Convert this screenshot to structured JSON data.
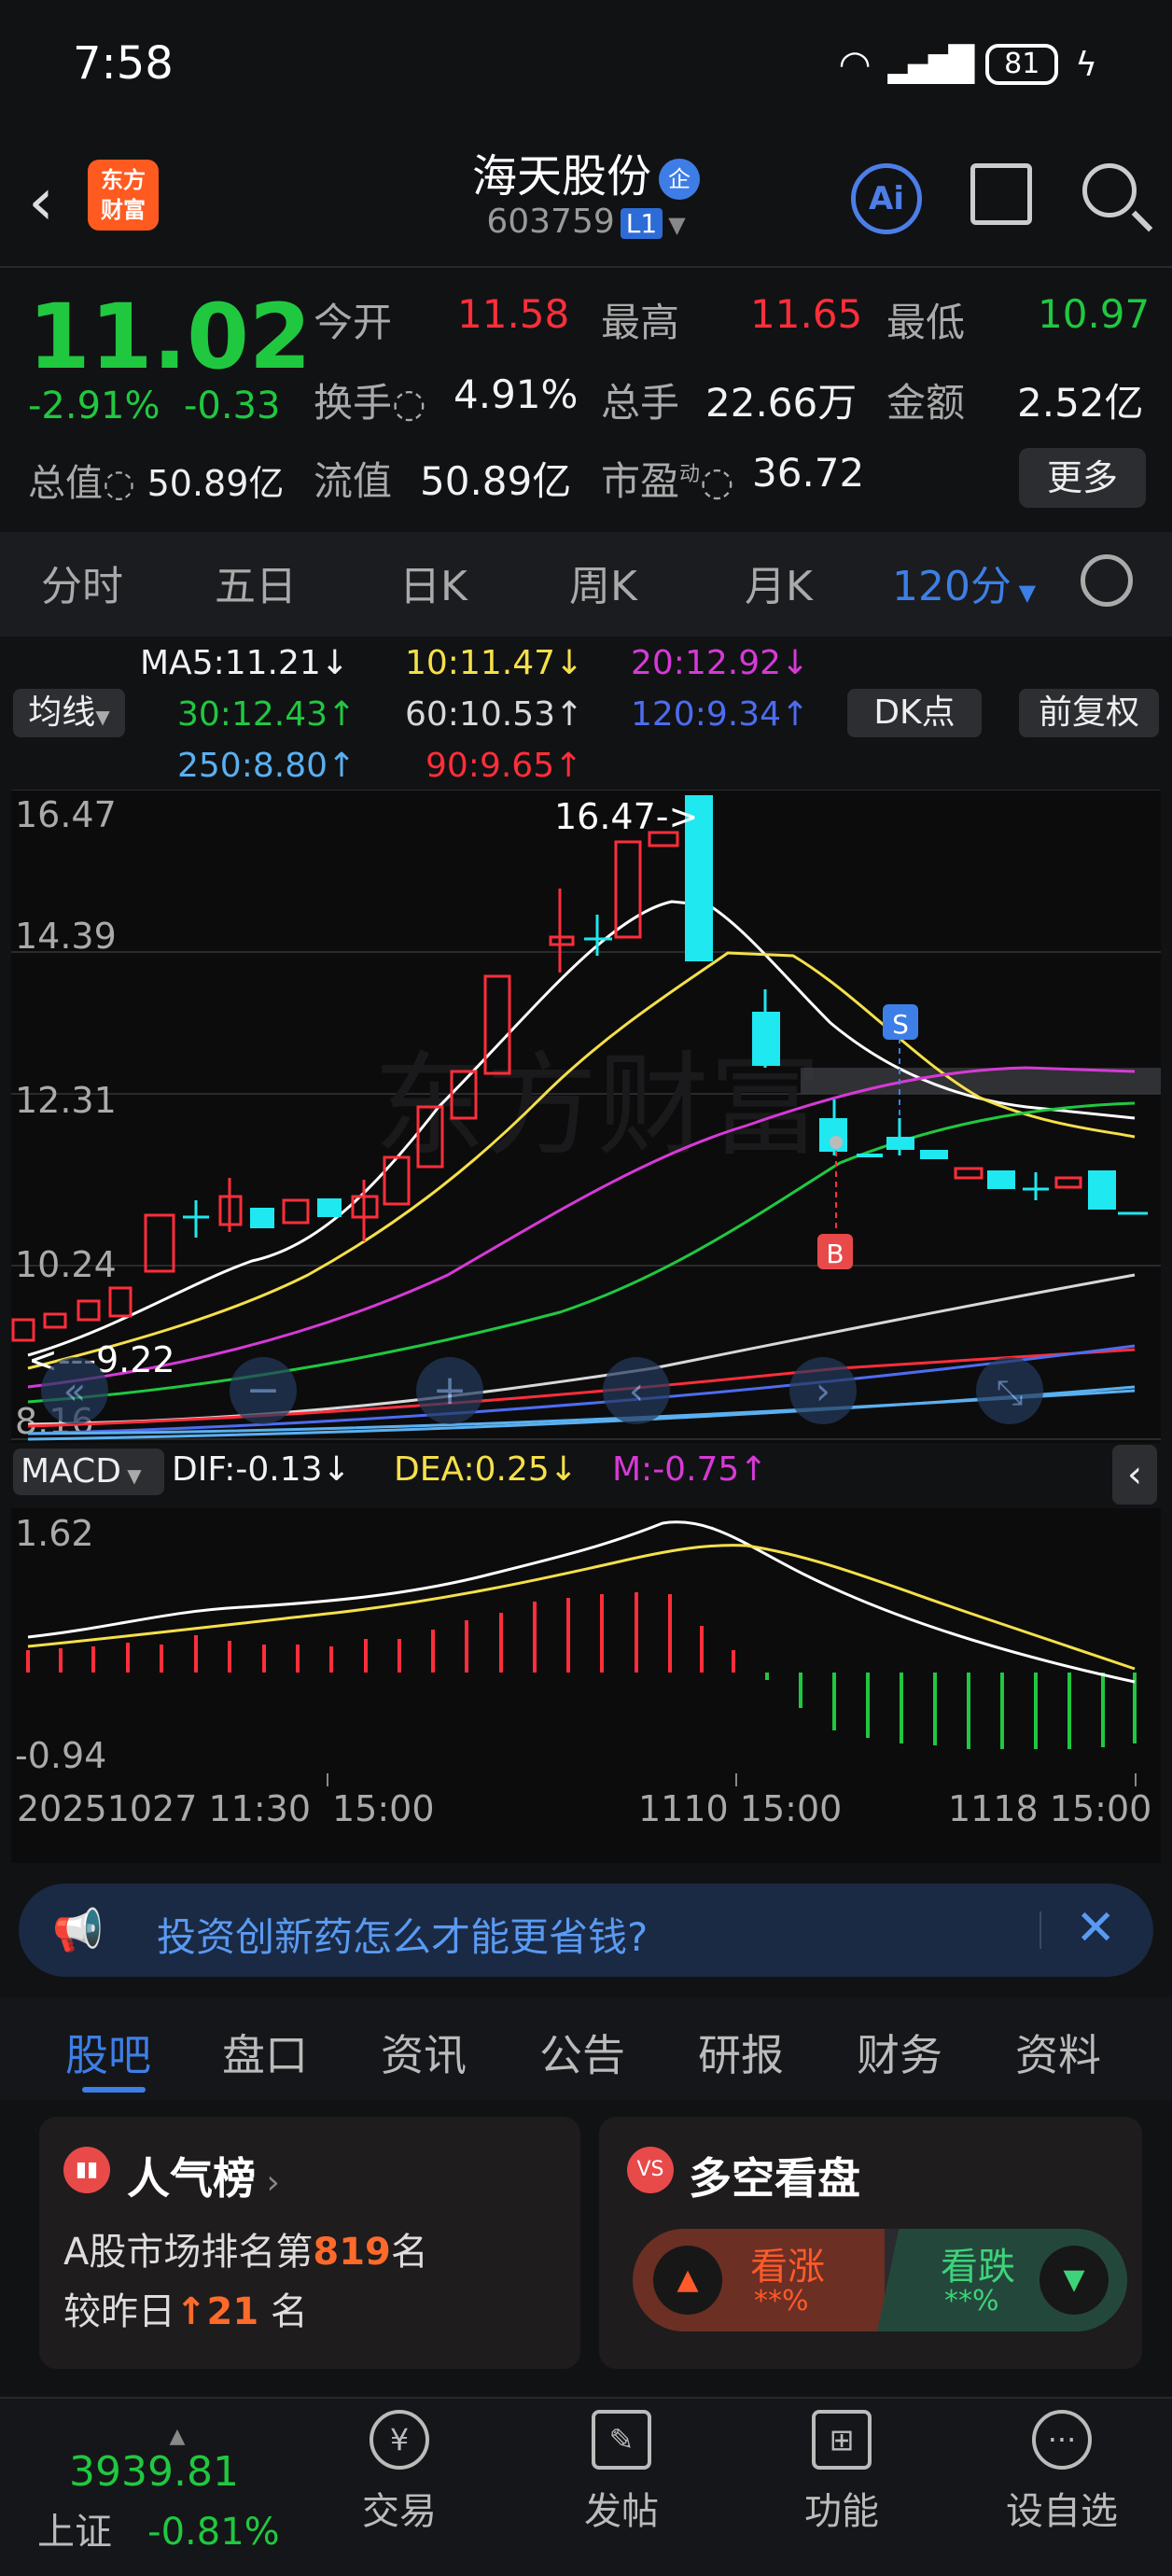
{
  "status": {
    "time": "7:58",
    "battery": "81"
  },
  "header": {
    "title": "海天股份",
    "badge": "企",
    "code": "603759",
    "level": "L1",
    "logo_text": "东方财富"
  },
  "quote": {
    "price": "11.02",
    "change_pct": "-2.91%",
    "change": "-0.33",
    "total_value_label": "总值",
    "total_value": "50.89亿",
    "fields": [
      {
        "label": "今开",
        "value": "11.58",
        "color": "red"
      },
      {
        "label": "最高",
        "value": "11.65",
        "color": "red"
      },
      {
        "label": "最低",
        "value": "10.97",
        "color": "green"
      },
      {
        "label": "换手",
        "value": "4.91%",
        "color": "white"
      },
      {
        "label": "总手",
        "value": "22.66万",
        "color": "white"
      },
      {
        "label": "金额",
        "value": "2.52亿",
        "color": "white"
      },
      {
        "label": "流值",
        "value": "50.89亿",
        "color": "white"
      },
      {
        "label": "市盈",
        "sup": "动",
        "value": "36.72",
        "color": "white"
      }
    ],
    "more_label": "更多"
  },
  "periods": [
    "分时",
    "五日",
    "日K",
    "周K",
    "月K",
    "120分"
  ],
  "ma_legend": {
    "selector": "均线",
    "items": [
      {
        "text": "MA5:11.21↓",
        "color": "#f2f2f2"
      },
      {
        "text": "10:11.47↓",
        "color": "#f5e04a"
      },
      {
        "text": "20:12.92↓",
        "color": "#d63ad6"
      },
      {
        "text": "30:12.43↑",
        "color": "#20c840"
      },
      {
        "text": "60:10.53↑",
        "color": "#d8d8d8"
      },
      {
        "text": "120:9.34↑",
        "color": "#4d6cf0"
      },
      {
        "text": "250:8.80↑",
        "color": "#5ab0f0"
      },
      {
        "text": "90:9.65↑",
        "color": "#ff2e3a"
      }
    ],
    "dk_label": "DK点",
    "adjust_label": "前复权"
  },
  "kchart": {
    "y_labels": [
      "16.47",
      "14.39",
      "12.31",
      "10.24",
      "8.16"
    ],
    "high_note": "16.47->",
    "low_note": "<---9.22",
    "markers": [
      "S",
      "B"
    ],
    "watermark": "东方财富"
  },
  "macd": {
    "selector": "MACD",
    "dif": "DIF:-0.13↓",
    "dea": "DEA:0.25↓",
    "m": "M:-0.75↑",
    "y_top": "1.62",
    "y_bottom": "-0.94"
  },
  "time_axis": [
    "20251027 11:30",
    "15:00",
    "1110 15:00",
    "1118 15:00"
  ],
  "banner": {
    "text": "投资创新药怎么才能更省钱?"
  },
  "content_tabs": [
    "股吧",
    "盘口",
    "资讯",
    "公告",
    "研报",
    "财务",
    "资料"
  ],
  "popularity": {
    "title": "人气榜",
    "rank_prefix": "A股市场排名第",
    "rank": "819",
    "rank_suffix": "名",
    "change_prefix": "较昨日",
    "change": "21",
    "change_suffix": "名"
  },
  "sentiment": {
    "title": "多空看盘",
    "up_label": "看涨",
    "up_pct": "**%",
    "down_label": "看跌",
    "down_pct": "**%"
  },
  "bottom_nav": {
    "index_value": "3939.81",
    "index_name": "上证",
    "index_change": "-0.81%",
    "items": [
      "交易",
      "发帖",
      "功能",
      "设自选"
    ]
  },
  "colors": {
    "up": "#ff2e3a",
    "down": "#20c840",
    "accent": "#3d7fe6",
    "candle_down": "#1fe8f0"
  }
}
